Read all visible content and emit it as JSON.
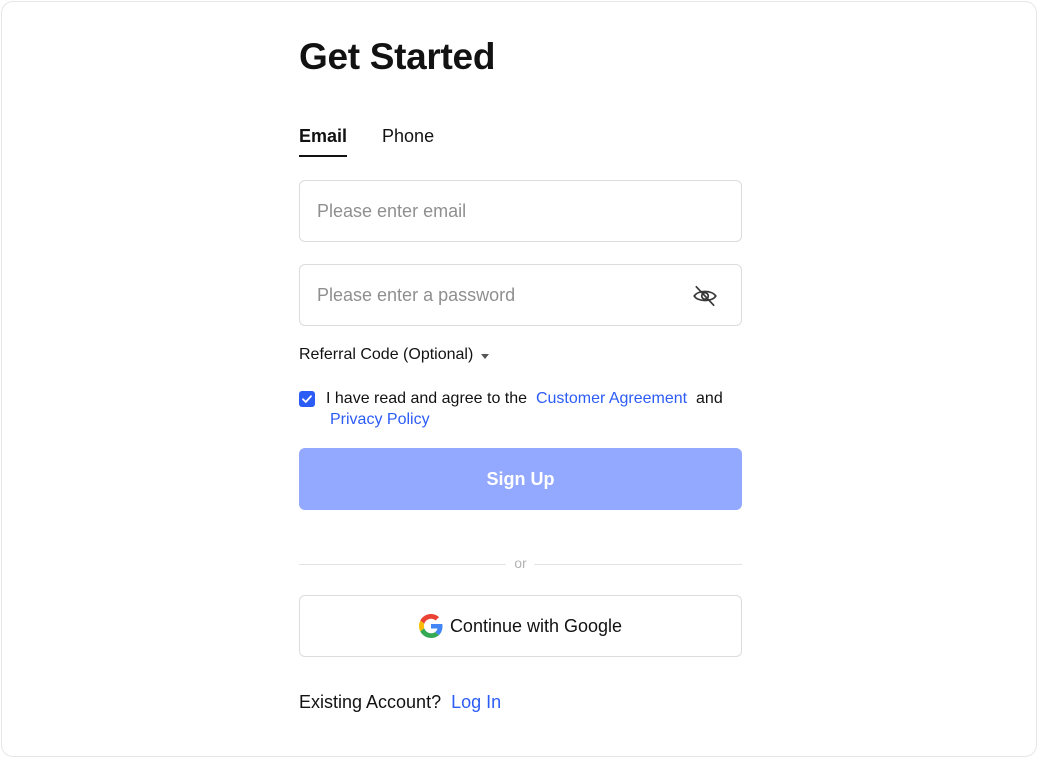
{
  "page": {
    "title": "Get Started"
  },
  "tabs": [
    {
      "label": "Email",
      "active": true
    },
    {
      "label": "Phone",
      "active": false
    }
  ],
  "form": {
    "email_placeholder": "Please enter email",
    "email_value": "",
    "password_placeholder": "Please enter a password",
    "password_value": "",
    "password_visibility_icon": "eye-off-icon",
    "referral_label": "Referral Code (Optional)",
    "agree_checked": true,
    "agree_prefix": "I have read and agree to the",
    "customer_agreement_link": "Customer Agreement",
    "agree_and": "and",
    "privacy_policy_link": "Privacy Policy",
    "signup_label": "Sign Up"
  },
  "divider": {
    "text": "or"
  },
  "google": {
    "label": "Continue with Google",
    "icon": "google-icon"
  },
  "footer": {
    "existing_text": "Existing Account?",
    "login_link": "Log In"
  },
  "colors": {
    "accent": "#2c5cf6",
    "signup_button_bg": "#93a8ff",
    "text": "#121212",
    "placeholder": "#8f8f8f",
    "border": "#dcdcdc"
  }
}
